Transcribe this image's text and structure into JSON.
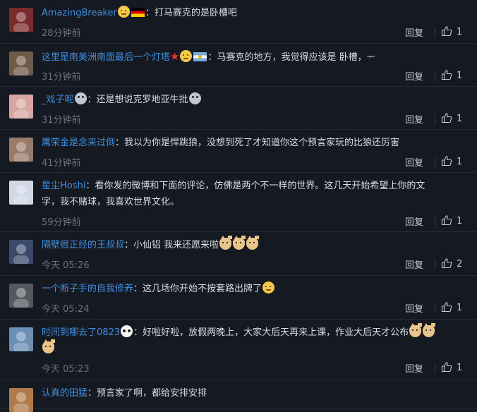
{
  "comments": [
    {
      "user": "AmazingBreaker",
      "emoji": [
        "face",
        "flag-de"
      ],
      "text": "：打马赛克的是卧槽吧",
      "time": "28分钟前",
      "reply": "回复",
      "likes": "1",
      "avatar_color": "#7a2b2b"
    },
    {
      "user": "这里是南美洲南面最后一个灯塔",
      "emoji": [
        "star",
        "face",
        "flag-ar"
      ],
      "text": "：马赛克的地方，我觉得应该是 卧槽，ᅮ",
      "time": "31分钟前",
      "reply": "回复",
      "likes": "1",
      "avatar_color": "#6e5a48"
    },
    {
      "user": "_戏子呢",
      "emoji": [
        "gray"
      ],
      "text": "：还是想说克罗地亚牛批",
      "text_emoji": [
        "gray"
      ],
      "time": "31分钟前",
      "reply": "回复",
      "likes": "1",
      "avatar_color": "#d8a6a0"
    },
    {
      "user": "厲荣金是念来过倒",
      "emoji": [],
      "text": "：我以为你是悍跳狼，没想到死了才知道你这个预言家玩的比狼还厉害",
      "time": "41分钟前",
      "reply": "回复",
      "likes": "1",
      "avatar_color": "#9a7b6a"
    },
    {
      "user": "星尘Hoshi",
      "emoji": [],
      "text": "：看你发的微博和下面的评论，仿佛是两个不一样的世界。这几天开始希望上你的文",
      "text2": "字，我不赌球，我喜欢世界文化。",
      "time": "59分钟前",
      "reply": "回复",
      "likes": "1",
      "avatar_color": "#cfd8e4"
    },
    {
      "user": "隔壁很正经的王叔叔",
      "emoji": [],
      "text": "：小仙铝 我来还愿来啦",
      "text_emoji": [
        "cat",
        "cat",
        "cat"
      ],
      "time": "今天 05:26",
      "reply": "回复",
      "likes": "2",
      "avatar_color": "#3b4a6b"
    },
    {
      "user": "一个断子手的自我修养",
      "emoji": [],
      "text": "：这几场你开始不按套路出牌了",
      "text_emoji": [
        "face"
      ],
      "time": "今天 05:24",
      "reply": "回复",
      "likes": "1",
      "avatar_color": "#55595f"
    },
    {
      "user": "时间到哪去了0823",
      "emoji": [
        "panda"
      ],
      "text": "：好啦好啦，放假两晚上，大家大后天再来上课，作业大后天才公布",
      "text_emoji": [
        "cat",
        "cat"
      ],
      "text2_emoji": [
        "cat"
      ],
      "time": "今天 05:23",
      "reply": "回复",
      "likes": "1",
      "avatar_color": "#6b8fb5"
    },
    {
      "user": "认真的田猛",
      "emoji": [],
      "text": "：预言家了啊，都给安排安排",
      "time": "",
      "reply": "",
      "likes": "",
      "avatar_color": "#b07a4a"
    }
  ]
}
